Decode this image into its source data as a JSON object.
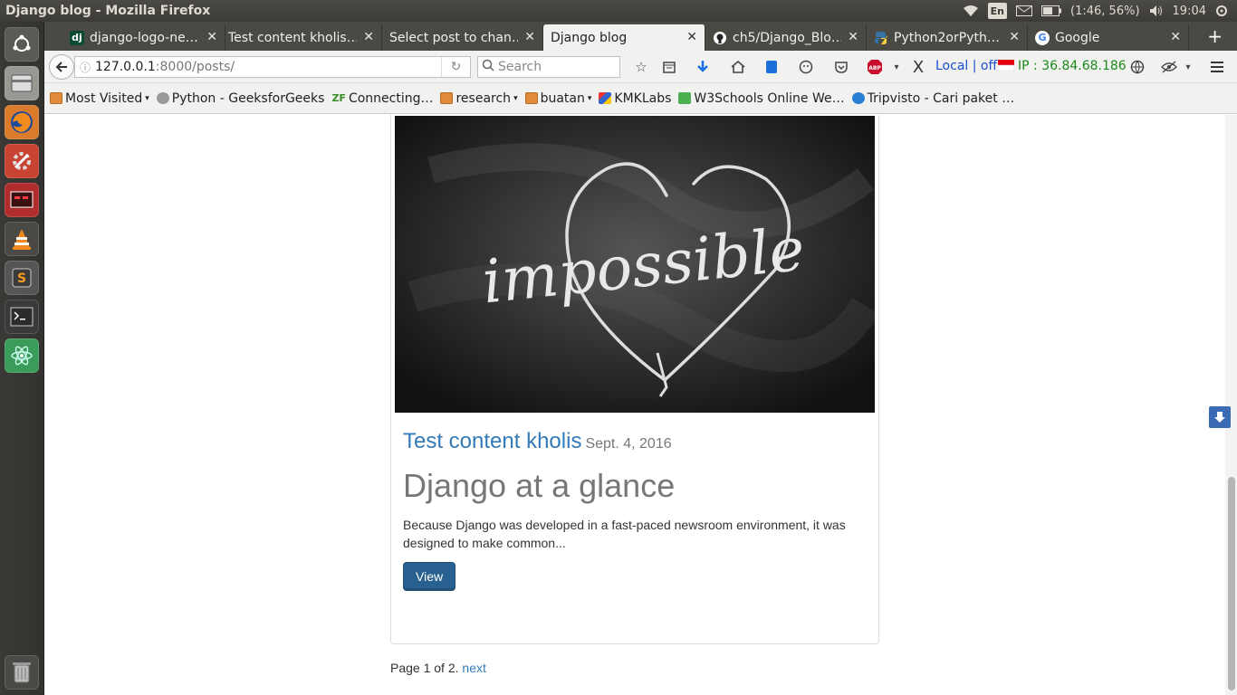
{
  "os": {
    "window_title": "Django blog - Mozilla Firefox",
    "tray": {
      "keyboard_layout": "En",
      "battery": "(1:46, 56%)",
      "time": "19:04"
    }
  },
  "launcher": {
    "items": [
      "ubuntu-dash",
      "files",
      "firefox",
      "settings",
      "remmina",
      "vlc",
      "sublime-text",
      "terminal",
      "atom"
    ],
    "trash": "trash"
  },
  "browser": {
    "tabs": [
      {
        "title": "django-logo-ne…",
        "icon": "dj"
      },
      {
        "title": "Test content kholis…",
        "icon": ""
      },
      {
        "title": "Select post to chan…",
        "icon": ""
      },
      {
        "title": "Django blog",
        "icon": "",
        "active": true
      },
      {
        "title": "ch5/Django_Blo…",
        "icon": "github"
      },
      {
        "title": "Python2orPyth…",
        "icon": "python"
      },
      {
        "title": "Google",
        "icon": "G"
      }
    ],
    "url": {
      "host": "127.0.0.1",
      "path": ":8000/posts/"
    },
    "search_placeholder": "Search",
    "addon_local": "Local | off",
    "addon_ip": "IP : 36.84.68.186",
    "abp": "ABP",
    "bookmarks": [
      "Most Visited",
      "Python - GeeksforGeeks",
      "Connecting…",
      "research",
      "buatan",
      "KMKLabs",
      "W3Schools Online We…",
      "Tripvisto - Cari paket …"
    ]
  },
  "page": {
    "post": {
      "image_text": "impossible",
      "author": "Test content kholis",
      "date": "Sept. 4, 2016",
      "title": "Django at a glance",
      "excerpt": "Because Django was developed in a fast-paced newsroom environment, it was designed to make common...",
      "view_label": "View"
    },
    "pagination": {
      "text": "Page 1 of 2.",
      "next_label": "next"
    }
  }
}
